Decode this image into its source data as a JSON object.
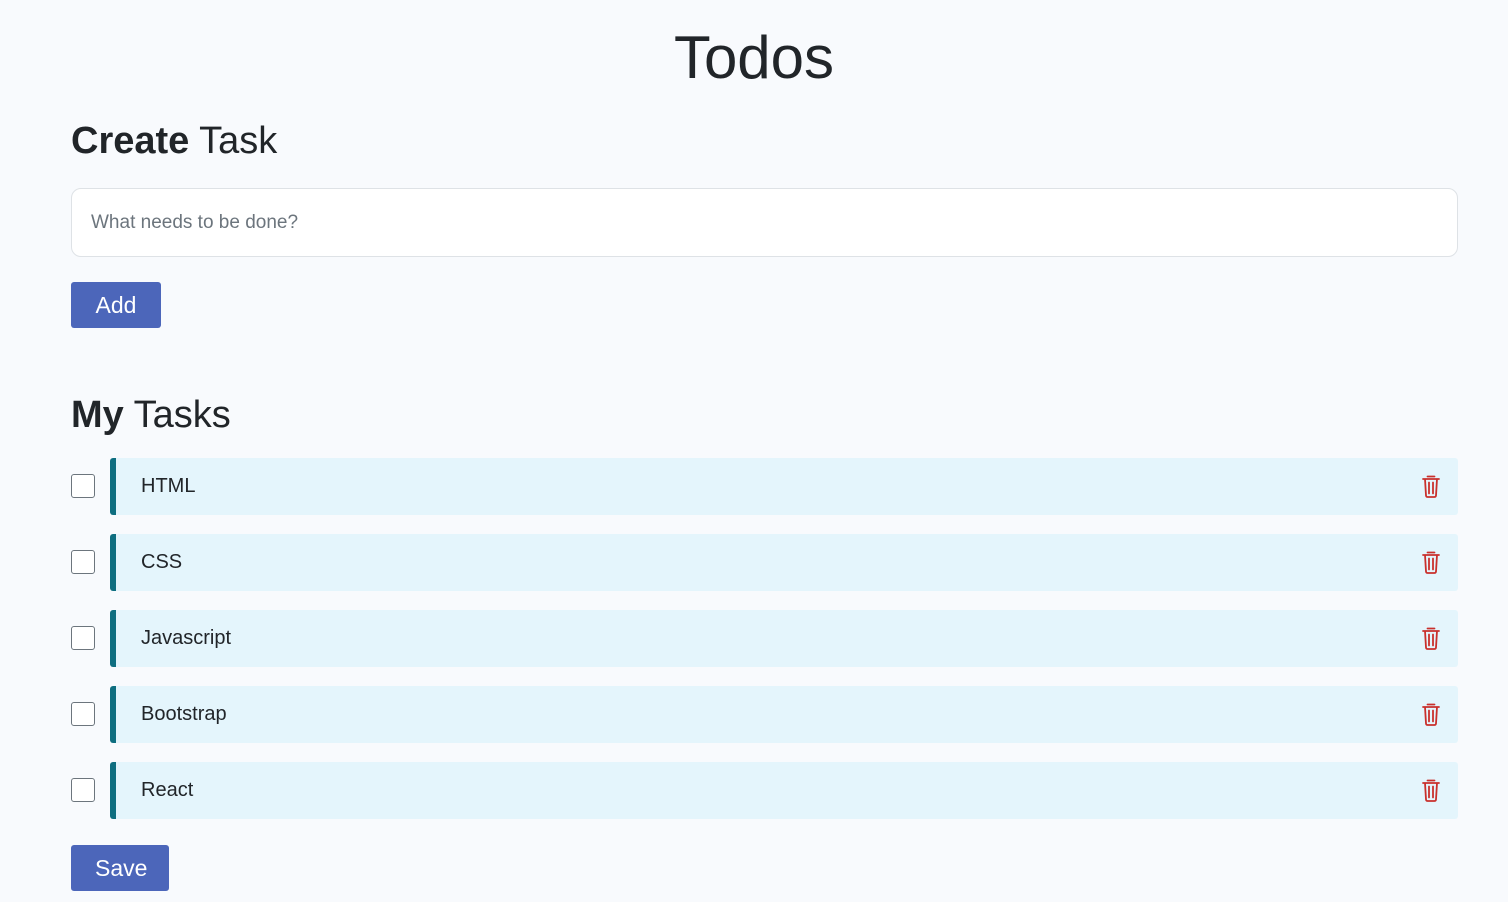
{
  "header": {
    "title": "Todos"
  },
  "create": {
    "title_strong": "Create",
    "title_rest": "Task",
    "input_placeholder": "What needs to be done?",
    "input_value": "",
    "add_label": "Add"
  },
  "tasks": {
    "title_strong": "My",
    "title_rest": "Tasks",
    "items": [
      {
        "label": "HTML",
        "done": false
      },
      {
        "label": "CSS",
        "done": false
      },
      {
        "label": "Javascript",
        "done": false
      },
      {
        "label": "Bootstrap",
        "done": false
      },
      {
        "label": "React",
        "done": false
      }
    ],
    "save_label": "Save"
  },
  "icons": {
    "delete": "trash-icon"
  },
  "colors": {
    "primary": "#4c66ba",
    "task_background": "#e4f5fc",
    "task_accent": "#0e6e80",
    "delete_icon": "#c9302c"
  }
}
